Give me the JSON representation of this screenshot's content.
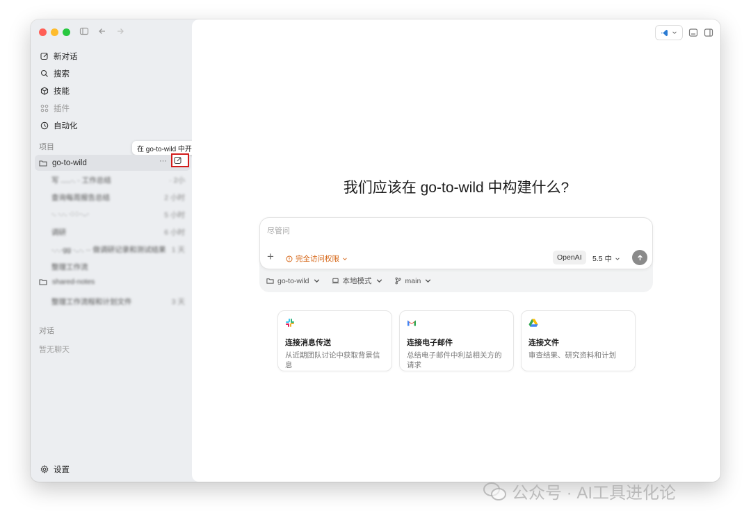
{
  "sidebar": {
    "nav": [
      {
        "label": "新对话",
        "icon": "compose-icon"
      },
      {
        "label": "搜索",
        "icon": "search-icon"
      },
      {
        "label": "技能",
        "icon": "cube-icon"
      },
      {
        "label": "插件",
        "icon": "grid-icon"
      },
      {
        "label": "自动化",
        "icon": "clock-icon"
      }
    ],
    "projects_label": "项目",
    "project": {
      "name": "go-to-wild",
      "more": "···"
    },
    "tooltip": "在 go-to-wild 中开始新对话",
    "threads": [
      {
        "title": "写 .....·. · 工作总结",
        "time": "· 2小"
      },
      {
        "title": "查询每周报告总结",
        "time": "2 小时"
      },
      {
        "title": "·. ·.·. ·:·:··..·",
        "time": "5 小时"
      },
      {
        "title": "调研",
        "time": "6 小时"
      },
      {
        "title": "·.·.·gg ·..·. ·· 做调研记录和测试结果",
        "time": "1 天"
      },
      {
        "title": "整理工作流",
        "time": ""
      }
    ],
    "folder": {
      "name": "shared-notes"
    },
    "folder_threads": [
      {
        "title": "整理工作流程和计划文件",
        "time": "3 天"
      }
    ],
    "conversations_label": "对话",
    "no_chats": "暂无聊天",
    "settings_label": "设置"
  },
  "main": {
    "headline": "我们应该在 go-to-wild 中构建什么?",
    "composer": {
      "placeholder": "尽管问",
      "access_label": "完全访问权限",
      "provider_label": "OpenAI",
      "model_label": "5.5 中"
    },
    "context_bar": {
      "project": "go-to-wild",
      "mode": "本地模式",
      "branch": "main"
    },
    "cards": [
      {
        "icon": "slack-icon",
        "title": "连接消息传送",
        "desc": "从近期团队讨论中获取背景信息"
      },
      {
        "icon": "gmail-icon",
        "title": "连接电子邮件",
        "desc": "总结电子邮件中利益相关方的请求"
      },
      {
        "icon": "google-drive-icon",
        "title": "连接文件",
        "desc": "审查结果、研究资料和计划"
      }
    ]
  },
  "watermark": "公众号 · AI工具进化论",
  "colors": {
    "accent_warning": "#d4600e",
    "highlight_box": "#d21b1b",
    "sidebar_bg": "#eceef1"
  }
}
